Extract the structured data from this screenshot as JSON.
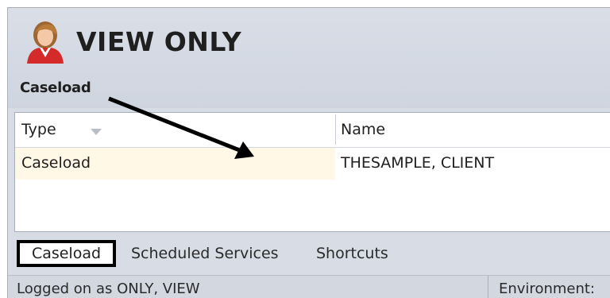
{
  "header": {
    "title": "VIEW ONLY",
    "subtitle": "Caseload"
  },
  "grid": {
    "columns": [
      "Type",
      "Name"
    ],
    "rows": [
      {
        "type": "Caseload",
        "name": "THESAMPLE, CLIENT"
      }
    ]
  },
  "tabs": [
    {
      "label": "Caseload",
      "active": true
    },
    {
      "label": "Scheduled Services",
      "active": false
    },
    {
      "label": "Shortcuts",
      "active": false
    }
  ],
  "status": {
    "logged_on": "Logged on as ONLY, VIEW",
    "environment": "Environment:"
  },
  "colors": {
    "header_bg": "#d7dce5",
    "selected_row": "#fff8e7",
    "avatar_hair": "#b97a3a",
    "avatar_shirt": "#d42a2a"
  },
  "icons": {
    "avatar": "user-avatar-icon",
    "sort": "sort-descending-icon"
  }
}
